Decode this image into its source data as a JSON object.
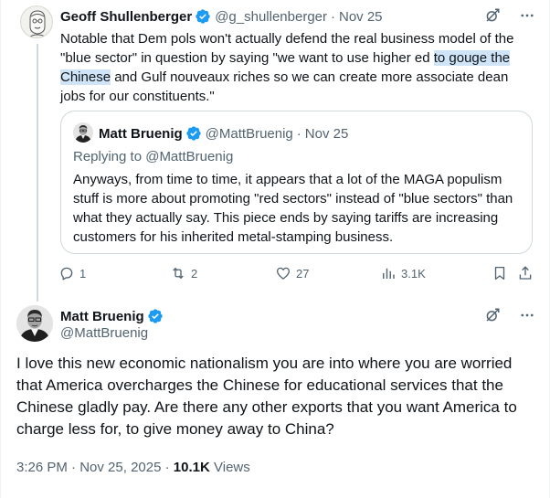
{
  "parent": {
    "name": "Geoff Shullenberger",
    "handle": "@g_shullenberger",
    "separator": "·",
    "date": "Nov 25",
    "text_before": "Notable that Dem pols won't actually defend the real business model of the \"blue sector\" in question by saying \"we want to use higher ed ",
    "text_highlight": "to gouge the Chinese",
    "text_after": " and Gulf nouveaux riches so we can create more associate dean jobs for our constituents.\""
  },
  "quote": {
    "name": "Matt Bruenig",
    "handle": "@MattBruenig",
    "separator": "·",
    "date": "Nov 25",
    "replying_to": "Replying to @MattBruenig",
    "text": "Anyways, from time to time, it appears that a lot of the MAGA populism stuff is more about promoting \"red sectors\" instead of \"blue sectors\" than what they actually say. This piece ends by saying tariffs are increasing customers for his inherited metal-stamping business."
  },
  "actions": {
    "replies": "1",
    "reposts": "2",
    "likes": "27",
    "views": "3.1K"
  },
  "main": {
    "name": "Matt Bruenig",
    "handle": "@MattBruenig",
    "text": "I love this new economic nationalism you are into where you are worried that America overcharges the Chinese for educational services that the Chinese gladly pay. Are there any other exports that you want America to charge less for, to give money away to China?",
    "time": "3:26 PM",
    "separator": "·",
    "date": "Nov 25, 2025",
    "views_count": "10.1K",
    "views_label": "Views"
  },
  "colors": {
    "verified": "#1d9bf0",
    "muted": "#536471",
    "highlight": "#cfe4f7",
    "border": "#cfd9de"
  },
  "icons": [
    "grok-icon",
    "more-icon",
    "reply-icon",
    "repost-icon",
    "like-icon",
    "views-icon",
    "bookmark-icon",
    "share-icon",
    "verified-badge-icon"
  ]
}
